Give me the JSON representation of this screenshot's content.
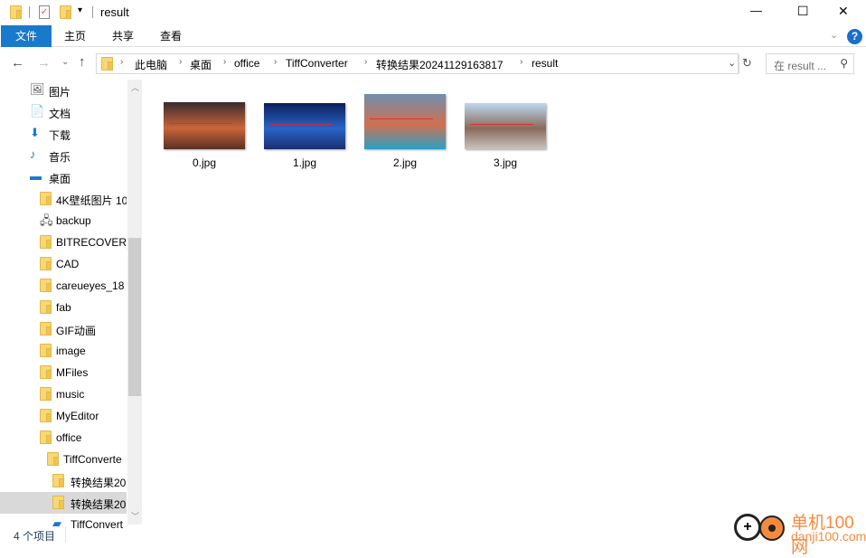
{
  "window": {
    "title": "result",
    "minimize": "—",
    "maximize": "☐",
    "close": "✕"
  },
  "ribbon": {
    "tabs": [
      {
        "label": "文件",
        "active": true
      },
      {
        "label": "主页"
      },
      {
        "label": "共享"
      },
      {
        "label": "查看"
      }
    ],
    "help": "?",
    "accent": "#1979ca"
  },
  "address": {
    "crumbs": [
      "此电脑",
      "桌面",
      "office",
      "TiffConverter",
      "转换结果20241129163817",
      "result"
    ]
  },
  "search": {
    "placeholder": "在 result ..."
  },
  "sidebar": {
    "items": [
      {
        "label": "图片",
        "icon": "pictures-icon",
        "level": 0
      },
      {
        "label": "文档",
        "icon": "documents-icon",
        "level": 0
      },
      {
        "label": "下载",
        "icon": "download-icon",
        "level": 0
      },
      {
        "label": "音乐",
        "icon": "music-icon",
        "level": 0
      },
      {
        "label": "桌面",
        "icon": "desktop-icon",
        "level": 0
      },
      {
        "label": "4K壁纸图片 10",
        "icon": "folder-icon",
        "level": 1
      },
      {
        "label": "backup",
        "icon": "network-folder-icon",
        "level": 1
      },
      {
        "label": "BITRECOVER_",
        "icon": "folder-icon",
        "level": 1
      },
      {
        "label": "CAD",
        "icon": "folder-icon",
        "level": 1
      },
      {
        "label": "careueyes_18",
        "icon": "folder-icon",
        "level": 1
      },
      {
        "label": "fab",
        "icon": "folder-icon",
        "level": 1
      },
      {
        "label": "GIF动画",
        "icon": "folder-icon",
        "level": 1
      },
      {
        "label": "image",
        "icon": "folder-icon",
        "level": 1
      },
      {
        "label": "MFiles",
        "icon": "folder-icon",
        "level": 1
      },
      {
        "label": "music",
        "icon": "folder-icon",
        "level": 1
      },
      {
        "label": "MyEditor",
        "icon": "folder-icon",
        "level": 1
      },
      {
        "label": "office",
        "icon": "folder-icon",
        "level": 1
      },
      {
        "label": "TiffConverte",
        "icon": "folder-icon",
        "level": 2
      },
      {
        "label": "转换结果20",
        "icon": "folder-icon",
        "level": 3
      },
      {
        "label": "转换结果20",
        "icon": "folder-icon",
        "level": 3,
        "selected": true
      },
      {
        "label": "TiffConvert",
        "icon": "app-folder-icon",
        "level": 3
      }
    ]
  },
  "files": [
    {
      "name": "0.jpg",
      "colors": [
        "#3a2a2e",
        "#c9653a",
        "#5a3024"
      ]
    },
    {
      "name": "1.jpg",
      "colors": [
        "#0c1f5a",
        "#2a64c8",
        "#1a2f70"
      ]
    },
    {
      "name": "2.jpg",
      "colors": [
        "#6f8fb0",
        "#d07050",
        "#2aa0c8"
      ]
    },
    {
      "name": "3.jpg",
      "colors": [
        "#bcd8f0",
        "#8a6a5a",
        "#c8c4c0"
      ]
    }
  ],
  "status": {
    "count": "4 个项目"
  },
  "watermark": {
    "text": "单机100网",
    "url": "danji100.com"
  }
}
